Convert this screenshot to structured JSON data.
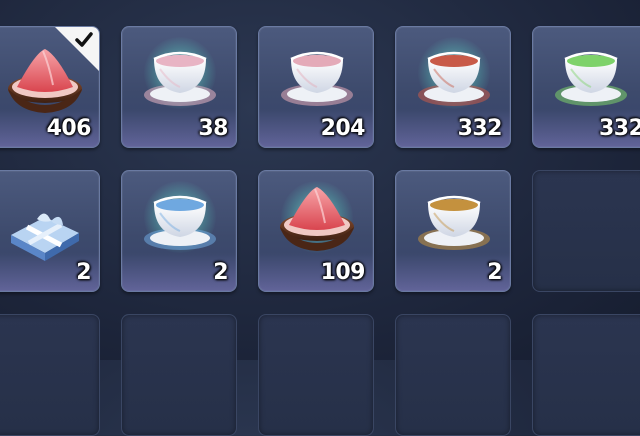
{
  "inventory": {
    "row1": [
      {
        "item": "salt-bowl-icon",
        "qty": "406",
        "selected": true
      },
      {
        "item": "pink-teacup-icon",
        "qty": "38",
        "glow": true
      },
      {
        "item": "pink-teacup-icon",
        "qty": "204"
      },
      {
        "item": "red-tea-icon",
        "qty": "332",
        "glow": true
      },
      {
        "item": "green-tea-icon",
        "qty": "332"
      }
    ],
    "row2": [
      {
        "item": "blue-gift-box-icon",
        "qty": "2"
      },
      {
        "item": "blue-teacup-icon",
        "qty": "2",
        "glow": true
      },
      {
        "item": "salt-bowl-icon",
        "qty": "109",
        "glow": true
      },
      {
        "item": "brown-tea-icon",
        "qty": "2"
      },
      {
        "item": "empty-slot",
        "qty": ""
      }
    ]
  },
  "colors": {
    "slot_bg": "#3d4a6c",
    "slot_border": "#6a7aa2",
    "glow": "#8cffe6",
    "pink_salt": "#e8626a",
    "bowl": "#6b3a24"
  }
}
